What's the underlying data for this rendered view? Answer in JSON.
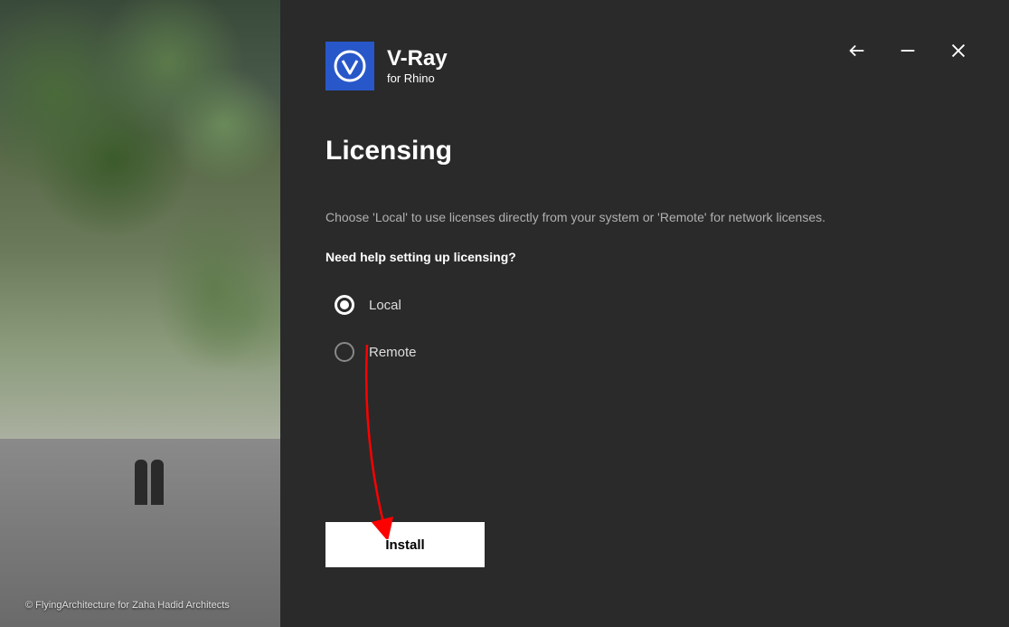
{
  "sidebar": {
    "credit": "© FlyingArchitecture for Zaha Hadid Architects"
  },
  "logo": {
    "title": "V-Ray",
    "subtitle": "for Rhino"
  },
  "page": {
    "title": "Licensing",
    "description": "Choose 'Local' to use licenses directly from your system or 'Remote' for network licenses.",
    "help_link": "Need help setting up licensing?"
  },
  "options": {
    "local": "Local",
    "remote": "Remote"
  },
  "actions": {
    "install": "Install"
  }
}
